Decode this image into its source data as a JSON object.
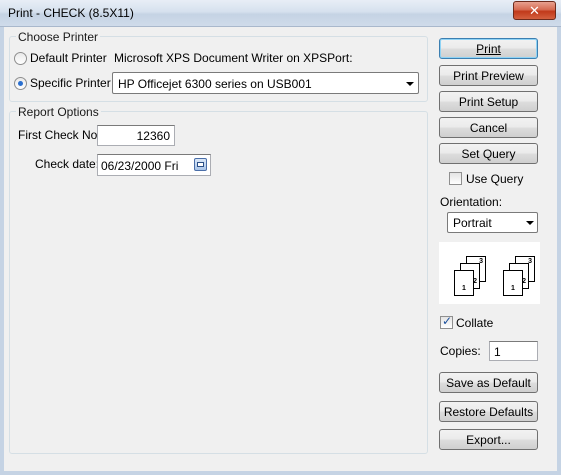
{
  "window": {
    "title": "Print - CHECK (8.5X11)",
    "close_glyph": "✕"
  },
  "choose_printer": {
    "legend": "Choose Printer",
    "default_label": "Default Printer",
    "default_printer_name": "Microsoft XPS Document Writer on XPSPort:",
    "specific_label": "Specific Printer",
    "specific_printer_value": "HP Officejet 6300 series on USB001"
  },
  "report_options": {
    "legend": "Report Options",
    "first_check_label": "First Check No.:",
    "first_check_value": "12360",
    "check_date_label": "Check date:",
    "check_date_value": "06/23/2000 Fri"
  },
  "buttons": {
    "print": "Print",
    "print_preview": "Print Preview",
    "print_setup": "Print Setup",
    "cancel": "Cancel",
    "set_query": "Set Query",
    "save_default": "Save as Default",
    "restore_defaults": "Restore Defaults",
    "export": "Export..."
  },
  "options": {
    "use_query_label": "Use Query",
    "use_query_checked": false,
    "orientation_label": "Orientation:",
    "orientation_value": "Portrait",
    "collate_label": "Collate",
    "collate_checked": true,
    "copies_label": "Copies:",
    "copies_value": "1",
    "collate_pages_1": [
      "1",
      "2",
      "3"
    ],
    "collate_pages_2": [
      "1",
      "2",
      "3"
    ]
  }
}
